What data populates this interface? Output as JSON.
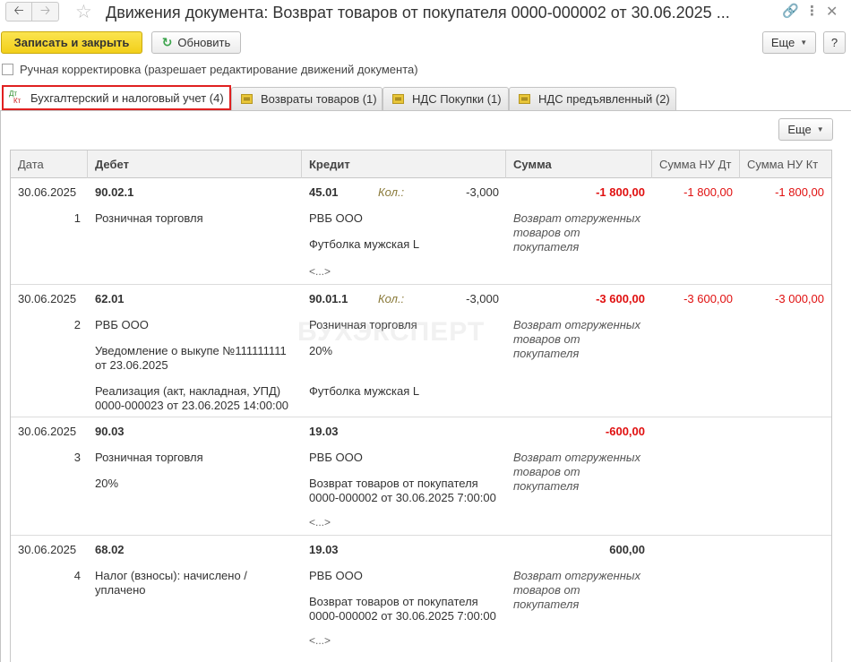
{
  "window": {
    "title": "Движения документа: Возврат товаров от покупателя 0000-000002 от 30.06.2025 ...",
    "back_icon": "arrow-left-icon",
    "forward_icon": "arrow-right-icon",
    "star_icon": "star-icon",
    "link_icon": "link-icon",
    "more_icon": "more-vertical-icon",
    "close_icon": "close-icon"
  },
  "toolbar": {
    "save_close_label": "Записать и закрыть",
    "refresh_label": "Обновить",
    "more_label": "Еще",
    "help_label": "?"
  },
  "manual_edit": {
    "label": "Ручная корректировка (разрешает редактирование движений документа)",
    "checked": false
  },
  "tabs": [
    {
      "label": "Бухгалтерский и налоговый учет (4)",
      "icon_top": "Дт",
      "icon_bottom": "Кт",
      "active": true
    },
    {
      "label": "Возвраты товаров (1)",
      "active": false
    },
    {
      "label": "НДС Покупки (1)",
      "active": false
    },
    {
      "label": "НДС предъявленный (2)",
      "active": false
    }
  ],
  "panel": {
    "more_label": "Еще"
  },
  "table": {
    "columns": {
      "date": "Дата",
      "debit": "Дебет",
      "credit": "Кредит",
      "sum": "Сумма",
      "sum_nu_dt": "Сумма НУ Дт",
      "sum_nu_kt": "Сумма НУ Кт"
    },
    "rows": [
      {
        "date": "30.06.2025",
        "num": "1",
        "debit_account": "90.02.1",
        "debit_sub1": "Розничная торговля",
        "debit_sub2": "",
        "debit_sub3": "",
        "credit_account": "45.01",
        "qty_label": "Кол.:",
        "qty": "-3,000",
        "credit_sub1": "РВБ ООО",
        "credit_sub2": "Футболка мужская L",
        "credit_sub3": "<...>",
        "sum": "-1 800,00",
        "comment": "Возврат отгруженных товаров от покупателя",
        "sum_nu_dt": "-1 800,00",
        "sum_nu_kt": "-1 800,00"
      },
      {
        "date": "30.06.2025",
        "num": "2",
        "debit_account": "62.01",
        "debit_sub1": "РВБ ООО",
        "debit_sub2": "Уведомление о выкупе №111111111 от 23.06.2025",
        "debit_sub3": "Реализация (акт, накладная, УПД) 0000-000023 от 23.06.2025 14:00:00",
        "credit_account": "90.01.1",
        "qty_label": "Кол.:",
        "qty": "-3,000",
        "credit_sub1": "Розничная торговля",
        "credit_sub2": "20%",
        "credit_sub3": "Футболка мужская L",
        "sum": "-3 600,00",
        "comment": "Возврат отгруженных товаров от покупателя",
        "sum_nu_dt": "-3 600,00",
        "sum_nu_kt": "-3 000,00"
      },
      {
        "date": "30.06.2025",
        "num": "3",
        "debit_account": "90.03",
        "debit_sub1": "Розничная торговля",
        "debit_sub2": "20%",
        "debit_sub3": "",
        "credit_account": "19.03",
        "qty_label": "",
        "qty": "",
        "credit_sub1": "РВБ ООО",
        "credit_sub2": "Возврат товаров от покупателя 0000-000002 от 30.06.2025 7:00:00",
        "credit_sub3": "<...>",
        "sum": "-600,00",
        "comment": "Возврат отгруженных товаров от покупателя",
        "sum_nu_dt": "",
        "sum_nu_kt": ""
      },
      {
        "date": "30.06.2025",
        "num": "4",
        "debit_account": "68.02",
        "debit_sub1": "Налог (взносы): начислено / уплачено",
        "debit_sub2": "",
        "debit_sub3": "",
        "credit_account": "19.03",
        "qty_label": "",
        "qty": "",
        "credit_sub1": "РВБ ООО",
        "credit_sub2": "Возврат товаров от покупателя 0000-000002 от 30.06.2025 7:00:00",
        "credit_sub3": "<...>",
        "sum": "600,00",
        "comment": "Возврат отгруженных товаров от покупателя",
        "sum_nu_dt": "",
        "sum_nu_kt": ""
      }
    ]
  },
  "watermark": "БУХЭКСПЕРТ",
  "colors": {
    "primary_button": "#f2cf1a",
    "negative_amount": "#e01010",
    "active_tab_outline": "#e02020"
  }
}
